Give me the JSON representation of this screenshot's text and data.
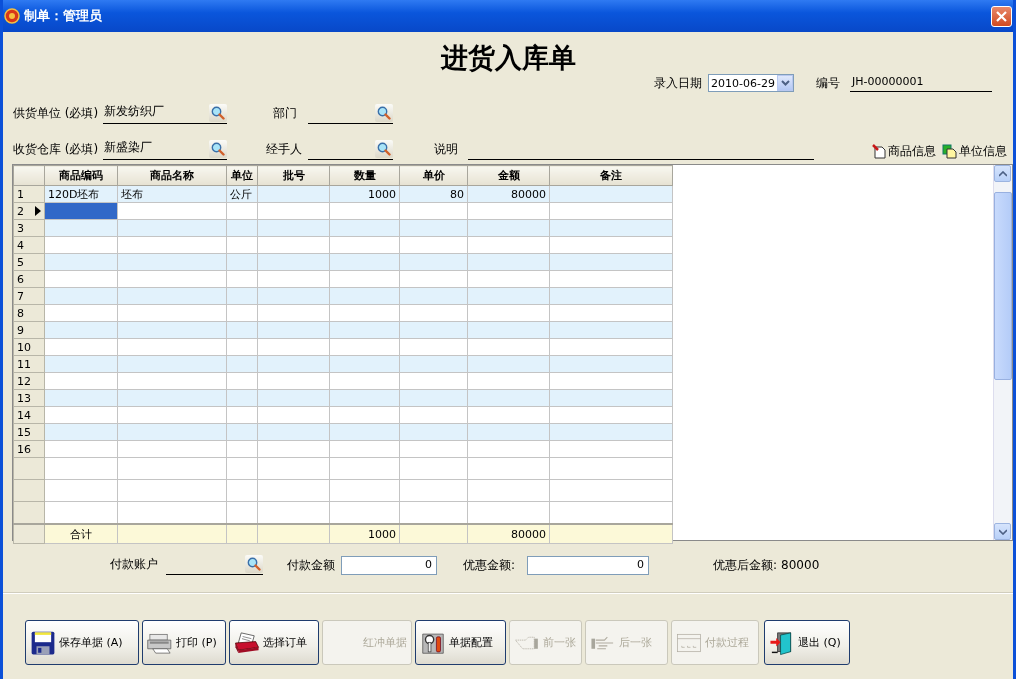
{
  "window": {
    "title": "制单：管理员"
  },
  "form": {
    "title": "进货入库单",
    "entry_date": {
      "label": "录入日期",
      "value": "2010-06-29"
    },
    "number": {
      "label": "编号",
      "value": "JH-00000001"
    },
    "supplier": {
      "label": "供货单位 (必填)",
      "value": "新发纺织厂"
    },
    "department": {
      "label": "部门"
    },
    "warehouse": {
      "label": "收货仓库 (必填)",
      "value": "新盛染厂"
    },
    "handler": {
      "label": "经手人"
    },
    "note": {
      "label": "说明"
    },
    "links": [
      "商品信息",
      "单位信息"
    ]
  },
  "grid": {
    "columns": [
      {
        "label": "商品编码"
      },
      {
        "label": "商品名称"
      },
      {
        "label": "单位"
      },
      {
        "label": "批号"
      },
      {
        "label": "数量"
      },
      {
        "label": "单价"
      },
      {
        "label": "金额"
      },
      {
        "label": "备注"
      }
    ],
    "rows": [
      {
        "number": "1",
        "current": false,
        "code": "120D坯布",
        "name": "坯布",
        "unit": "公斤",
        "quantity": "1000",
        "price": "80",
        "amount": "80000"
      },
      {
        "number": "2",
        "current": true
      },
      {
        "number": "3",
        "current": false
      },
      {
        "number": "4",
        "current": false
      },
      {
        "number": "5",
        "current": false
      },
      {
        "number": "6",
        "current": false
      },
      {
        "number": "7",
        "current": false
      },
      {
        "number": "8",
        "current": false
      },
      {
        "number": "9",
        "current": false
      },
      {
        "number": "10",
        "current": false
      },
      {
        "number": "11",
        "current": false
      },
      {
        "number": "12",
        "current": false
      },
      {
        "number": "13",
        "current": false
      },
      {
        "number": "14",
        "current": false
      },
      {
        "number": "15",
        "current": false
      },
      {
        "number": "16",
        "current": false
      }
    ],
    "total": {
      "label": "合计",
      "quantity": "1000",
      "amount": "80000"
    }
  },
  "payment": {
    "account": {
      "label": "付款账户"
    },
    "amount": {
      "label": "付款金额",
      "value": "0"
    },
    "discount": {
      "label": "优惠金额:",
      "value": "0"
    },
    "after_discount": {
      "label": "优惠后金额:",
      "value": "80000"
    }
  },
  "buttons": [
    {
      "label": "保存单据 (A)",
      "disabled": false
    },
    {
      "label": "打印 (P)",
      "disabled": false
    },
    {
      "label": "选择订单",
      "disabled": false
    },
    {
      "label": "红冲单据",
      "disabled": true
    },
    {
      "label": "单据配置",
      "disabled": false
    },
    {
      "label": "前一张",
      "disabled": true
    },
    {
      "label": "后一张",
      "disabled": true
    },
    {
      "label": "付款过程",
      "disabled": true
    },
    {
      "label": "退出 (Q)",
      "disabled": false
    }
  ]
}
